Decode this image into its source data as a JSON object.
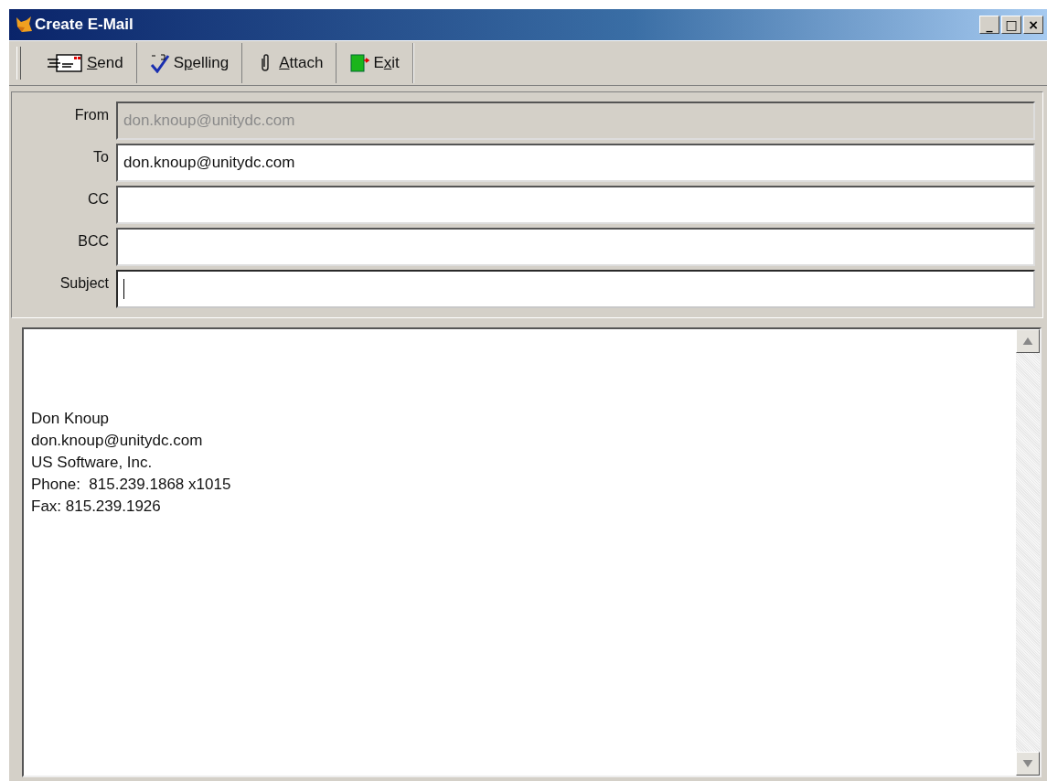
{
  "window": {
    "title": "Create E-Mail",
    "controls": [
      "_",
      "□",
      "×"
    ]
  },
  "toolbar": [
    {
      "kind": "send",
      "access_key": "S",
      "label_rest": "end"
    },
    {
      "kind": "spelling",
      "label_start": "S",
      "access_key": "p",
      "label_rest": "elling"
    },
    {
      "kind": "attach",
      "access_key": "A",
      "label_rest": "ttach"
    },
    {
      "kind": "exit",
      "label_start": "E",
      "access_key": "x",
      "label_rest": "it"
    }
  ],
  "fields": [
    {
      "label": "From",
      "value": "don.knoup@unitydc.com",
      "disabled": true,
      "focused": false
    },
    {
      "label": "To",
      "value": "don.knoup@unitydc.com",
      "disabled": false,
      "focused": false
    },
    {
      "label": "CC",
      "disabled": false,
      "focused": false
    },
    {
      "label": "BCC",
      "disabled": false,
      "focused": false
    },
    {
      "label": "Subject",
      "disabled": false,
      "focused": true
    }
  ],
  "body": {
    "lines": [
      "Don Knoup",
      "don.knoup@unitydc.com",
      "US Software, Inc.",
      "Phone:  815.239.1868 x1015",
      "Fax: 815.239.1926"
    ]
  }
}
